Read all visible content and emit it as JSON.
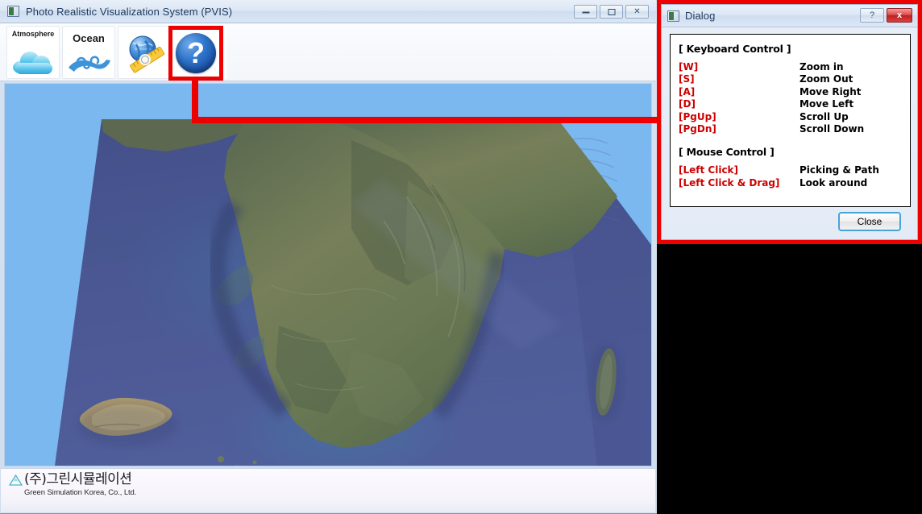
{
  "main_window": {
    "title": "Photo Realistic Visualization System (PVIS)",
    "window_buttons": {
      "minimize": "minimize-button",
      "maximize": "maximize-button",
      "close": "close-button"
    },
    "toolbar": {
      "buttons": [
        {
          "label": "Atmosphere",
          "icon": "cloud-icon"
        },
        {
          "label": "Ocean",
          "icon": "waves-icon"
        },
        {
          "label": "",
          "icon": "globe-ruler-icon"
        },
        {
          "label": "?",
          "icon": "help-question-icon"
        }
      ]
    },
    "viewport": {
      "scene": "3D terrain visualization of the Korean peninsula",
      "sky_color": "#7cb8f0",
      "ocean_color": "#47528f"
    },
    "statusbar": {
      "logo_korean": "(주)그린시뮬레이션",
      "logo_english": "Green Simulation Korea, Co., Ltd."
    }
  },
  "annotation": {
    "color": "#ee0000",
    "description": "red callout connecting help toolbar button to dialog"
  },
  "dialog": {
    "title": "Dialog",
    "help_button_label": "?",
    "close_button_label": "x",
    "sections": [
      {
        "heading": "[ Keyboard Control ]",
        "rows": [
          {
            "key": "[W]",
            "action": "Zoom in"
          },
          {
            "key": "[S]",
            "action": "Zoom Out"
          },
          {
            "key": "[A]",
            "action": "Move Right"
          },
          {
            "key": "[D]",
            "action": "Move Left"
          },
          {
            "key": "[PgUp]",
            "action": "Scroll Up"
          },
          {
            "key": "[PgDn]",
            "action": "Scroll Down"
          }
        ]
      },
      {
        "heading": "[ Mouse Control ]",
        "rows": [
          {
            "key": "[Left Click]",
            "action": "Picking & Path"
          },
          {
            "key": "[Left Click & Drag]",
            "action": "Look around"
          }
        ]
      }
    ],
    "footer_button": "Close",
    "key_color": "#cc0000",
    "action_color": "#000000"
  }
}
